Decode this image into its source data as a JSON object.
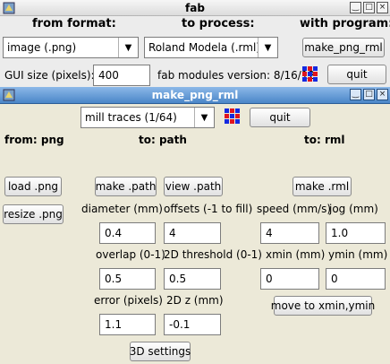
{
  "top_window": {
    "title": "fab",
    "buttons": [
      "‿",
      "□",
      "×"
    ],
    "headers": {
      "from": "from format:",
      "process": "to process:",
      "program": "with program:"
    },
    "format_select": "image (.png)",
    "process_select": "Roland Modela (.rml)",
    "program_button": "make_png_rml",
    "gui_size_label": "GUI size (pixels):",
    "gui_size_value": "400",
    "version_text": "fab modules version: 8/16/12",
    "quit_label": "quit"
  },
  "sub_window": {
    "title": "make_png_rml",
    "buttons": [
      "‿",
      "□",
      "×"
    ],
    "mode_select": "mill traces (1/64)",
    "quit_label": "quit",
    "col_headers": {
      "from": "from: png",
      "path": "to: path",
      "rml": "to: rml"
    },
    "buttons_left": {
      "load": "load .png",
      "resize": "resize .png"
    },
    "make_path": "make .path",
    "view_path": "view .path",
    "make_rml": "make .rml",
    "path_params": {
      "diameter_label": "diameter (mm)",
      "diameter": "0.4",
      "offsets_label": "offsets (-1 to fill)",
      "offsets": "4",
      "overlap_label": "overlap (0-1)",
      "overlap": "0.5",
      "threshold_label": "2D threshold (0-1)",
      "threshold": "0.5",
      "error_label": "error (pixels)",
      "error": "1.1",
      "z_label": "2D z (mm)",
      "z": "-0.1"
    },
    "rml_params": {
      "speed_label": "speed (mm/s)",
      "speed": "4",
      "jog_label": "jog (mm)",
      "jog": "1.0",
      "xmin_label": "xmin (mm)",
      "xmin": "0",
      "ymin_label": "ymin (mm)",
      "ymin": "0"
    },
    "move_button": "move to xmin,ymin",
    "settings_button": "3D settings"
  },
  "colors": {
    "dot_red": "#e0141e",
    "dot_blue": "#1428e0",
    "title_blue": "#4a86c8"
  }
}
